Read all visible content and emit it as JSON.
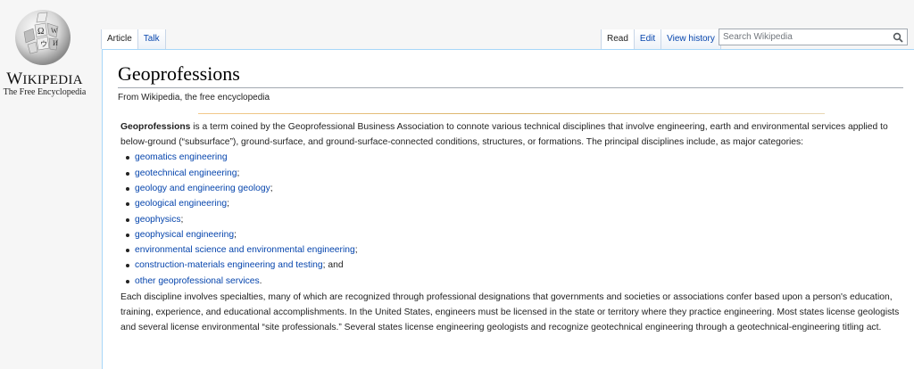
{
  "logo": {
    "wordmark_big": "W",
    "wordmark_rest": "IKIPEDIA",
    "tagline": "The Free Encyclopedia"
  },
  "tabs": {
    "article": "Article",
    "talk": "Talk",
    "read": "Read",
    "edit": "Edit",
    "view_history": "View history"
  },
  "search": {
    "placeholder": "Search Wikipedia"
  },
  "article": {
    "title": "Geoprofessions",
    "site_sub": "From Wikipedia, the free encyclopedia",
    "intro_bold": "Geoprofessions",
    "intro_rest": " is a term coined by the Geoprofessional Business Association to connote various technical disciplines that involve engineering, earth and environmental services applied to below-ground (“subsurface”), ground-surface, and ground-surface-connected conditions, structures, or formations. The principal disciplines include, as major categories:",
    "list": [
      {
        "link": "geomatics engineering",
        "suffix": ""
      },
      {
        "link": "geotechnical engineering",
        "suffix": ";"
      },
      {
        "link": "geology and engineering geology",
        "suffix": ";"
      },
      {
        "link": "geological engineering",
        "suffix": ";"
      },
      {
        "link": "geophysics",
        "suffix": ";"
      },
      {
        "link": "geophysical engineering",
        "suffix": ";"
      },
      {
        "link": "environmental science and environmental engineering",
        "suffix": ";"
      },
      {
        "link": "construction-materials engineering and testing",
        "suffix": "; and"
      },
      {
        "link": "other geoprofessional services",
        "suffix": "."
      }
    ],
    "paragraph2": "Each discipline involves specialties, many of which are recognized through professional designations that governments and societies or associations confer based upon a person's education, training, experience, and educational accomplishments. In the United States, engineers must be licensed in the state or territory where they practice engineering. Most states license geologists and several license environmental “site professionals.” Several states license engineering geologists and recognize geotechnical engineering through a geotechnical-engineering titling act."
  },
  "colors": {
    "link": "#0645ad",
    "content_border": "#a7d7f9",
    "background": "#f6f6f6"
  }
}
